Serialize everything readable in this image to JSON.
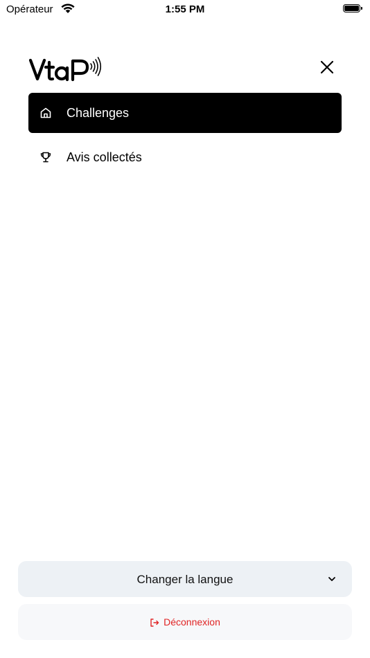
{
  "status_bar": {
    "carrier": "Opérateur",
    "time": "1:55 PM",
    "battery_level": 1.0
  },
  "header": {
    "logo_text": "VtaP",
    "close_icon": "close-icon"
  },
  "menu": {
    "items": [
      {
        "label": "Challenges",
        "icon": "home-icon",
        "active": true
      },
      {
        "label": "Avis collectés",
        "icon": "trophy-icon",
        "active": false
      }
    ]
  },
  "language": {
    "label": "Changer la langue",
    "icon": "chevron-down-icon"
  },
  "logout": {
    "label": "Déconnexion",
    "icon": "logout-icon",
    "color": "#e02424"
  },
  "colors": {
    "active_bg": "#000000",
    "select_bg": "#edf1f5",
    "logout_bg": "#f7f8fa"
  }
}
